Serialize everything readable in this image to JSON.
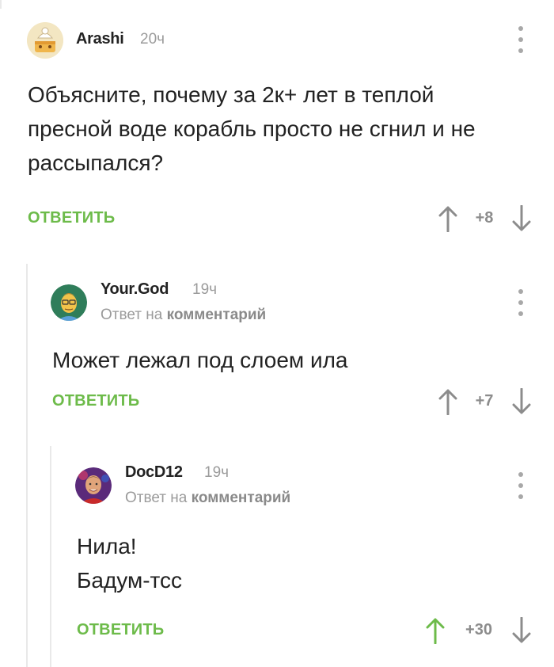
{
  "comments": [
    {
      "author": "Arashi",
      "time": "20ч",
      "lines": [
        "Объясните, почему за 2к+ лет в теплой",
        "пресной воде корабль просто не сгнил и не",
        "рассыпался?"
      ],
      "reply_label": "ОТВЕТИТЬ",
      "rating": "+8"
    },
    {
      "author": "Your.God",
      "time": "19ч",
      "reply_to_prefix": "Ответ на",
      "reply_to_link": "комментарий",
      "lines": [
        "Может лежал под слоем ила"
      ],
      "reply_label": "ОТВЕТИТЬ",
      "rating": "+7"
    },
    {
      "author": "DocD12",
      "time": "19ч",
      "reply_to_prefix": "Ответ на",
      "reply_to_link": "комментарий",
      "lines": [
        "Нила!",
        "Бадум-тсс"
      ],
      "reply_label": "ОТВЕТИТЬ",
      "rating": "+30",
      "upvoted": true
    }
  ],
  "colors": {
    "accent_green": "#6dbb4a",
    "meta_gray": "#9b9b9b",
    "thread_line": "#e9e9e9"
  },
  "icons": {
    "more": "more-vertical-icon",
    "up": "arrow-up-icon",
    "down": "arrow-down-icon"
  }
}
